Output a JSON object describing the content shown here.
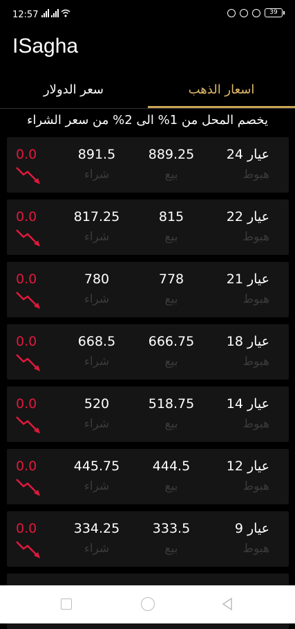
{
  "status": {
    "time": "12:57",
    "battery": "39"
  },
  "app": {
    "title": "ISagha"
  },
  "tabs": [
    {
      "label": "اسعار الذهب",
      "active": true
    },
    {
      "label": "سعر الدولار",
      "active": false
    }
  ],
  "notice": "يخصم المحل من 1% الى 2% من سعر الشراء",
  "labels": {
    "trend": "هبوط",
    "sell": "بيع",
    "buy": "شراء"
  },
  "colors": {
    "accent": "#c9a456",
    "down": "#e0193d",
    "card": "#151515"
  },
  "rows": [
    {
      "karat": "عيار 24",
      "sell": "889.25",
      "buy": "891.5",
      "change": "0.0",
      "trend_icon": "down-trend-icon"
    },
    {
      "karat": "عيار 22",
      "sell": "815",
      "buy": "817.25",
      "change": "0.0",
      "trend_icon": "down-trend-icon"
    },
    {
      "karat": "عيار 21",
      "sell": "778",
      "buy": "780",
      "change": "0.0",
      "trend_icon": "down-trend-icon"
    },
    {
      "karat": "عيار 18",
      "sell": "666.75",
      "buy": "668.5",
      "change": "0.0",
      "trend_icon": "down-trend-icon"
    },
    {
      "karat": "عيار 14",
      "sell": "518.75",
      "buy": "520",
      "change": "0.0",
      "trend_icon": "down-trend-icon"
    },
    {
      "karat": "عيار 12",
      "sell": "444.5",
      "buy": "445.75",
      "change": "0.0",
      "trend_icon": "down-trend-icon"
    },
    {
      "karat": "عيار 9",
      "sell": "333.5",
      "buy": "334.25",
      "change": "0.0",
      "trend_icon": "down-trend-icon"
    }
  ]
}
